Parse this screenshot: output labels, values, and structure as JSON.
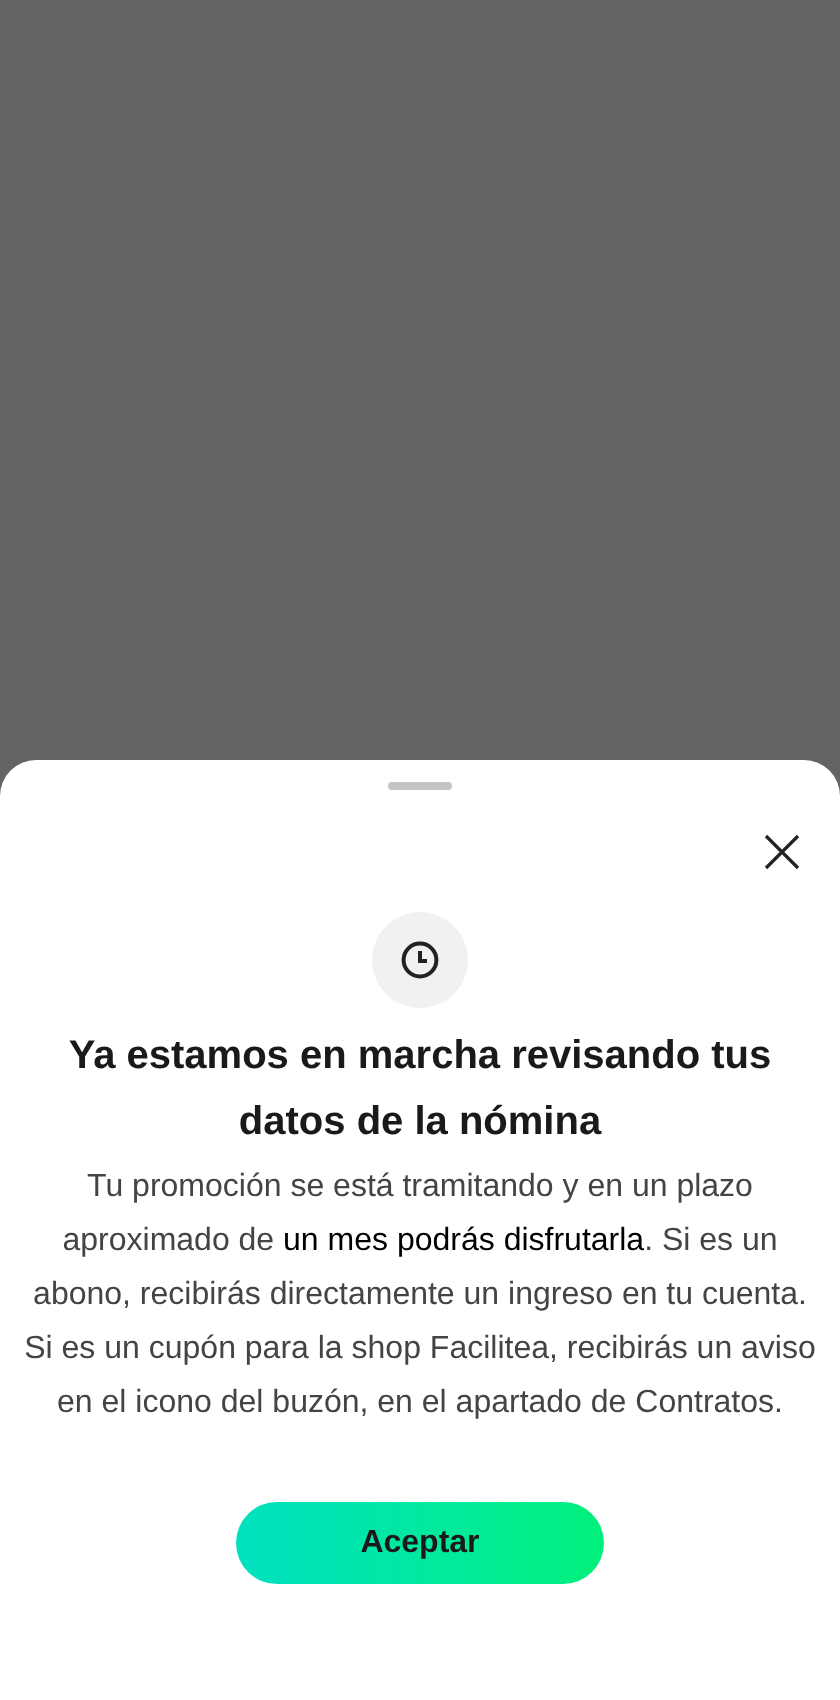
{
  "sheet": {
    "title": "Ya estamos en marcha revisando tus datos de la nómina",
    "message": "Tu promoción se está tramitando y en un plazo aproximado de **un mes podrás disfrutarla**. Si es un abono, recibirás directamente un ingreso en tu cuenta. Si es un cupón para la shop Facilitea, recibirás un aviso en el icono del buzón, en el apartado de Contratos.",
    "button": "Aceptar"
  }
}
